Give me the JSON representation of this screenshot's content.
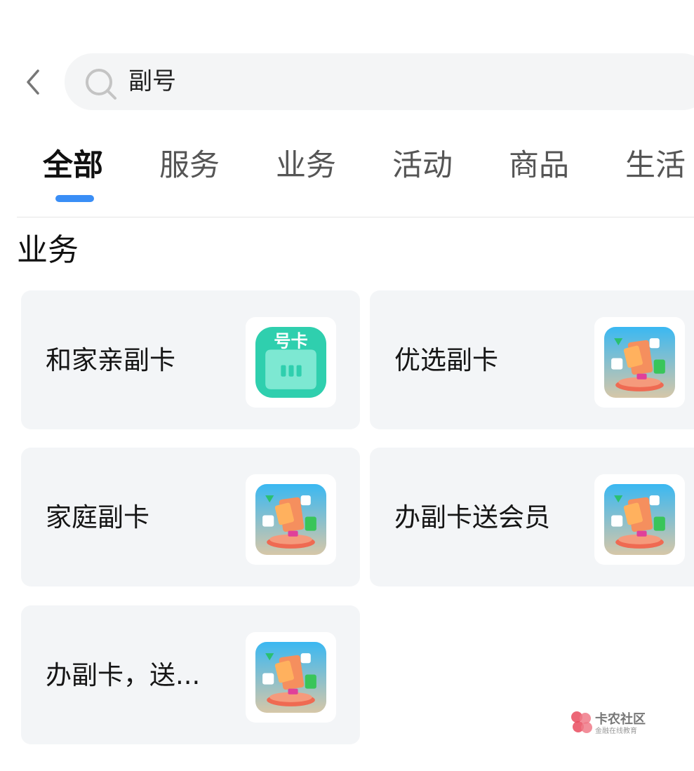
{
  "search": {
    "query": "副号"
  },
  "tabs": [
    {
      "label": "全部",
      "active": true
    },
    {
      "label": "服务"
    },
    {
      "label": "业务"
    },
    {
      "label": "活动"
    },
    {
      "label": "商品"
    },
    {
      "label": "生活"
    }
  ],
  "section": {
    "title": "业务"
  },
  "cards": [
    {
      "label": "和家亲副卡",
      "icon": "sim-card-app-icon"
    },
    {
      "label": "优选副卡",
      "icon": "member-cards-app-icon"
    },
    {
      "label": "家庭副卡",
      "icon": "member-cards-app-icon"
    },
    {
      "label": "办副卡送会员",
      "icon": "member-cards-app-icon"
    },
    {
      "label": "办副卡，送...",
      "icon": "member-cards-app-icon"
    }
  ],
  "sim_icon_text": "号卡",
  "watermark": {
    "name": "卡农社区",
    "tagline": "金融在线教育"
  },
  "colors": {
    "accent": "#3a8ef6",
    "card_bg": "#f3f5f7",
    "search_bg": "#f4f5f6",
    "sim_icon": "#2fcfae"
  }
}
